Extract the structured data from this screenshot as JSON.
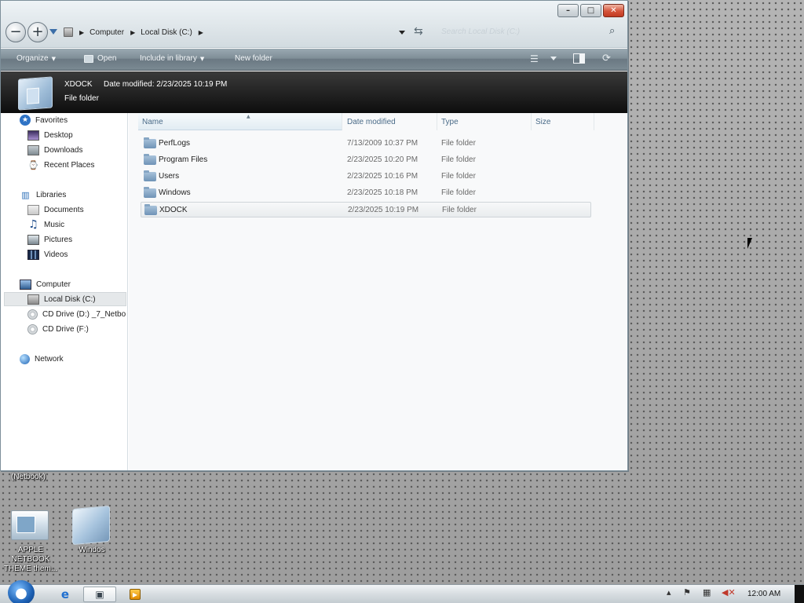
{
  "window": {
    "caption_buttons": [
      "–",
      "□",
      "✕"
    ],
    "nav": {
      "back_icon": "−",
      "forward_icon": "+"
    },
    "breadcrumb": [
      "Computer",
      "Local Disk (C:)"
    ],
    "search_placeholder": "Search Local Disk (C:)"
  },
  "toolbar": {
    "organize": "Organize",
    "open": "Open",
    "include_in_library": "Include in library",
    "new_folder": "New folder"
  },
  "details": {
    "name": "XDOCK",
    "date_modified": "Date modified:  2/23/2025 10:19 PM",
    "type": "File folder"
  },
  "nav_pane": {
    "favorites": "Favorites",
    "favorites_items": [
      "Desktop",
      "Downloads",
      "Recent Places"
    ],
    "libraries": "Libraries",
    "libraries_items": [
      "Documents",
      "Music",
      "Pictures",
      "Videos"
    ],
    "computer": "Computer",
    "computer_items": [
      "Local Disk (C:)",
      "CD Drive (D:) _7_Netbo",
      "CD Drive (F:)"
    ],
    "network": "Network",
    "selected": "Local Disk (C:)"
  },
  "file_list": {
    "columns": [
      "Name",
      "Date modified",
      "Type",
      "Size"
    ],
    "rows": [
      {
        "name": "PerfLogs",
        "date": "7/13/2009 10:37 PM",
        "type": "File folder"
      },
      {
        "name": "Program Files",
        "date": "2/23/2025 10:20 PM",
        "type": "File folder"
      },
      {
        "name": "Users",
        "date": "2/23/2025 10:16 PM",
        "type": "File folder"
      },
      {
        "name": "Windows",
        "date": "2/23/2025 10:18 PM",
        "type": "File folder"
      },
      {
        "name": "XDOCK",
        "date": "2/23/2025 10:19 PM",
        "type": "File folder"
      }
    ],
    "selected_row": "XDOCK"
  },
  "desktop": {
    "caption": "(Netbook)",
    "icons": [
      {
        "label": "APPLE NETBOOK THEME them..."
      },
      {
        "label": "Windos"
      }
    ]
  },
  "taskbar": {
    "clock": "12:00 AM"
  }
}
